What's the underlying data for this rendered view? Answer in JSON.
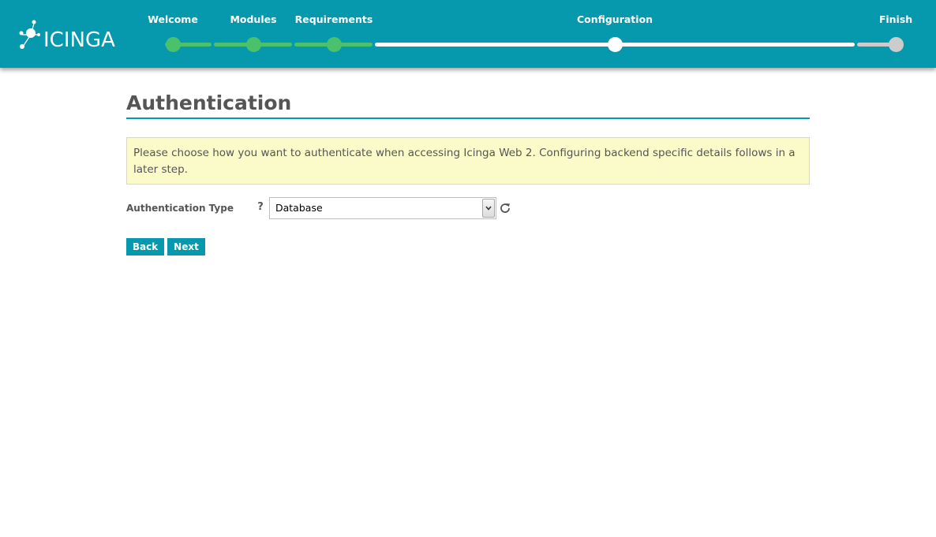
{
  "header": {
    "logo_text": "ICINGA",
    "steps": [
      {
        "label": "Welcome",
        "state": "done"
      },
      {
        "label": "Modules",
        "state": "done"
      },
      {
        "label": "Requirements",
        "state": "done"
      },
      {
        "label": "Configuration",
        "state": "current"
      },
      {
        "label": "Finish",
        "state": "pending"
      }
    ]
  },
  "page": {
    "title": "Authentication",
    "info": "Please choose how you want to authenticate when accessing Icinga Web 2. Configuring backend specific details follows in a later step."
  },
  "form": {
    "auth_type_label": "Authentication Type",
    "help_glyph": "?",
    "auth_type_value": "Database",
    "icons": {
      "help": "help-icon",
      "refresh": "refresh-icon",
      "dropdown": "chevron-down-icon"
    }
  },
  "buttons": {
    "back": "Back",
    "next": "Next"
  },
  "colors": {
    "header_bg": "#0699ad",
    "step_done": "#4cc16b",
    "step_current": "#ffffff",
    "step_pending": "#cccccc",
    "info_bg": "#fafbc8"
  }
}
